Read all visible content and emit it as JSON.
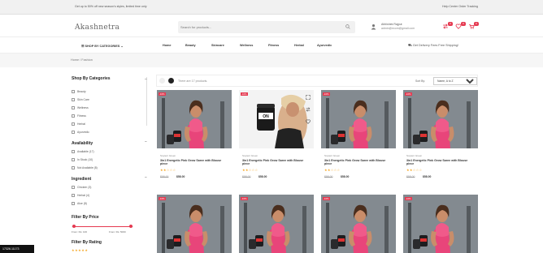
{
  "topbar": {
    "promo": "Get up to 50% off new season's styles, limited time only",
    "links": "Help Center   Order Tracking"
  },
  "header": {
    "logo": "Akashnetra",
    "search_placeholder": "Search for products...",
    "user_name": "Abhishek Rajput",
    "user_email": "admin@ecom@gmail.com",
    "icons": [
      "compare-icon",
      "wishlist-icon",
      "cart-icon"
    ],
    "badge_count": "0"
  },
  "nav": {
    "categories_label": "SHOP BY CATEGORIES",
    "menu": [
      "Home",
      "Beauty",
      "Skincare",
      "Wellness",
      "Fitness",
      "Herbal",
      "Ayurvedic"
    ],
    "shipping": "Get Delivery Fees Free Shipping!"
  },
  "breadcrumb": "Home  /  Fashion",
  "sidebar": {
    "categories_title": "Shop By Categories",
    "categories": [
      "Beauty",
      "Skin Care",
      "Wellness",
      "Fitness",
      "Herbal",
      "Ayurvedic"
    ],
    "availability_title": "Availability",
    "availability": [
      "Available (17)",
      "In Stock (10)",
      "Not Available (8)"
    ],
    "ingredient_title": "Ingredient",
    "ingredients": [
      "Chicken (3)",
      "Herbal (4)",
      "Aloe (8)"
    ],
    "price_title": "Filter By Price",
    "price_from": "From: Rs: 100",
    "price_to": "From: Rs: 5000",
    "rating_title": "Filter By Rating",
    "rating_stars": "★★★★★"
  },
  "toolbar": {
    "count_text": "There are 17 products.",
    "sort_label": "Sort By:",
    "sort_value": "Name, A to Z"
  },
  "products": [
    {
      "brand": "Soylent Green",
      "name": "3in1 Energetic Pink Grow Saree with Blouse piece",
      "stars": "★★☆☆☆",
      "old_price": "$58.00",
      "price": "$58.00"
    },
    {
      "brand": "Soylent Green",
      "name": "3in1 Energetic Pink Grow Saree with Blouse piece",
      "stars": "★★☆☆☆",
      "old_price": "$58.00",
      "price": "$58.00"
    },
    {
      "brand": "Soylent Green",
      "name": "3in1 Energetic Pink Grow Saree with Blouse piece",
      "stars": "★★☆☆☆",
      "old_price": "$58.00",
      "price": "$58.00"
    },
    {
      "brand": "Soylent Green",
      "name": "3in1 Energetic Pink Grow Saree with Blouse piece",
      "stars": "★★☆☆☆",
      "old_price": "$58.00",
      "price": "$58.00"
    }
  ],
  "sale_badge": "-10%",
  "status_text": "17326.11173",
  "colors": {
    "accent": "#e53950",
    "star": "#f5a623"
  }
}
